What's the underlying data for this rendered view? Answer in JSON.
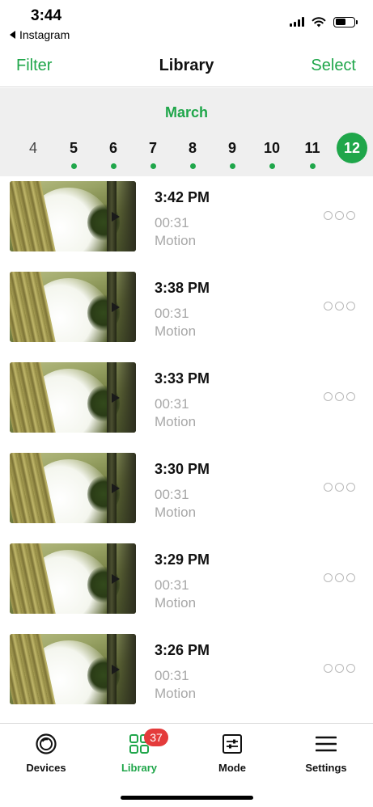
{
  "status_bar": {
    "time": "3:44",
    "back_app": "Instagram"
  },
  "nav": {
    "left": "Filter",
    "title": "Library",
    "right": "Select"
  },
  "date_strip": {
    "month": "March",
    "days": [
      {
        "num": "4",
        "has_events": false,
        "selected": false
      },
      {
        "num": "5",
        "has_events": true,
        "selected": false
      },
      {
        "num": "6",
        "has_events": true,
        "selected": false
      },
      {
        "num": "7",
        "has_events": true,
        "selected": false
      },
      {
        "num": "8",
        "has_events": true,
        "selected": false
      },
      {
        "num": "9",
        "has_events": true,
        "selected": false
      },
      {
        "num": "10",
        "has_events": true,
        "selected": false
      },
      {
        "num": "11",
        "has_events": true,
        "selected": false
      },
      {
        "num": "12",
        "has_events": false,
        "selected": true
      }
    ]
  },
  "clips": [
    {
      "time": "3:42 PM",
      "duration": "00:31",
      "type": "Motion"
    },
    {
      "time": "3:38 PM",
      "duration": "00:31",
      "type": "Motion"
    },
    {
      "time": "3:33 PM",
      "duration": "00:31",
      "type": "Motion"
    },
    {
      "time": "3:30 PM",
      "duration": "00:31",
      "type": "Motion"
    },
    {
      "time": "3:29 PM",
      "duration": "00:31",
      "type": "Motion"
    },
    {
      "time": "3:26 PM",
      "duration": "00:31",
      "type": "Motion"
    },
    {
      "time": "",
      "duration": "",
      "type": ""
    }
  ],
  "tabs": [
    {
      "label": "Devices",
      "icon": "camera-ring-icon",
      "active": false
    },
    {
      "label": "Library",
      "icon": "grid-icon",
      "active": true,
      "badge": "37"
    },
    {
      "label": "Mode",
      "icon": "sliders-icon",
      "active": false
    },
    {
      "label": "Settings",
      "icon": "menu-icon",
      "active": false
    }
  ],
  "colors": {
    "accent": "#1fa64a",
    "badge": "#e43b3b",
    "strip_bg": "#efefef",
    "muted_text": "#a8a8a8"
  }
}
